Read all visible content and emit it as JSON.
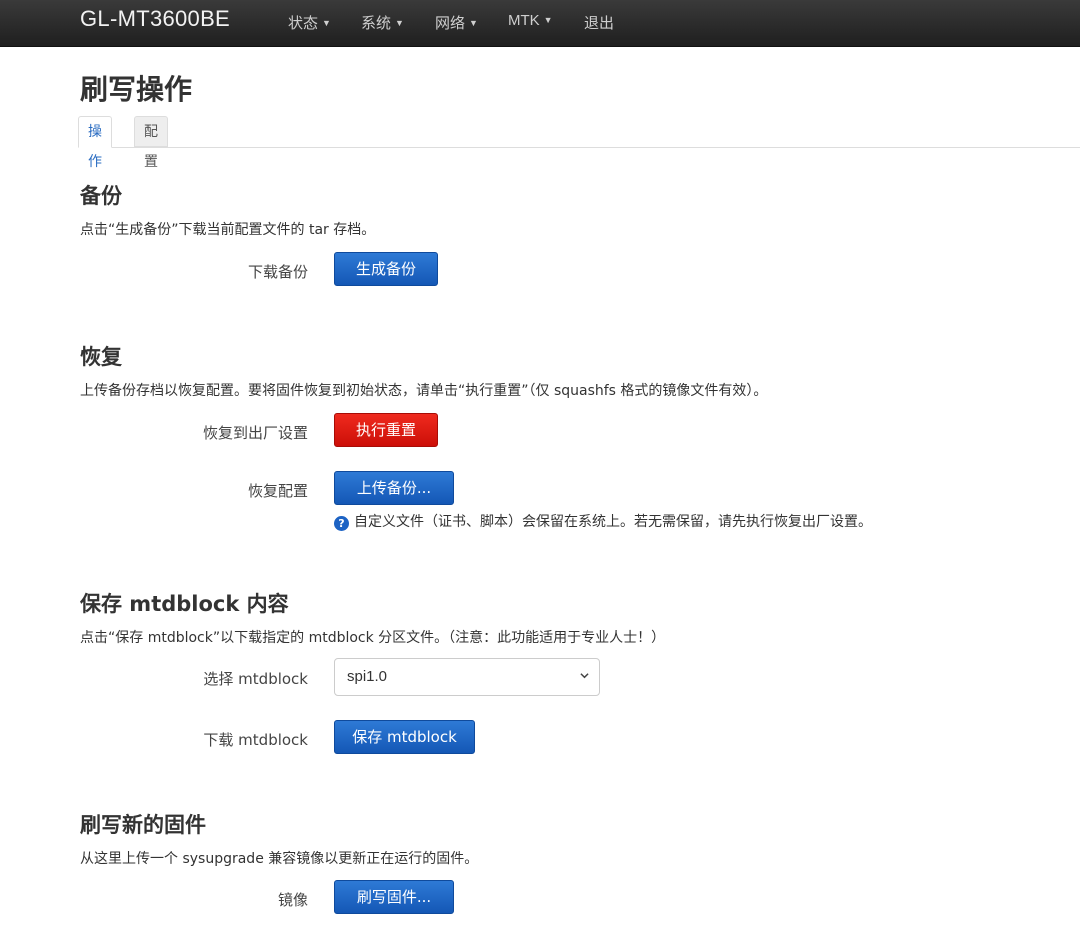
{
  "navbar": {
    "brand": "GL-MT3600BE",
    "menu": [
      "状态",
      "系统",
      "网络",
      "MTK",
      "退出"
    ]
  },
  "page": {
    "title": "刷写操作",
    "tabs": [
      {
        "label": "操作",
        "active": true
      },
      {
        "label": "配置",
        "active": false
      }
    ]
  },
  "backup": {
    "title": "备份",
    "description": "点击“生成备份”下载当前配置文件的 tar 存档。",
    "download_label": "下载备份",
    "generate_button": "生成备份"
  },
  "restore": {
    "title": "恢复",
    "description": "上传备份存档以恢复配置。要将固件恢复到初始状态，请单击“执行重置”（仅 squashfs 格式的镜像文件有效）。",
    "factory_label": "恢复到出厂设置",
    "reset_button": "执行重置",
    "config_label": "恢复配置",
    "upload_button": "上传备份...",
    "help_icon": "?",
    "help_text": "自定义文件（证书、脚本）会保留在系统上。若无需保留，请先执行恢复出厂设置。"
  },
  "mtdblock": {
    "title": "保存 mtdblock 内容",
    "description": "点击“保存 mtdblock”以下载指定的 mtdblock 分区文件。（注意：此功能适用于专业人士！）",
    "select_label": "选择 mtdblock",
    "select_value": "spi1.0",
    "download_label": "下载 mtdblock",
    "save_button": "保存 mtdblock"
  },
  "firmware": {
    "title": "刷写新的固件",
    "description": "从这里上传一个 sysupgrade 兼容镜像以更新正在运行的固件。",
    "image_label": "镜像",
    "flash_button": "刷写固件..."
  },
  "colors": {
    "navbar_bg": "#262626",
    "primary": "#1a63c2",
    "danger": "#e0190f",
    "tab_active_text": "#2a6cc2"
  }
}
